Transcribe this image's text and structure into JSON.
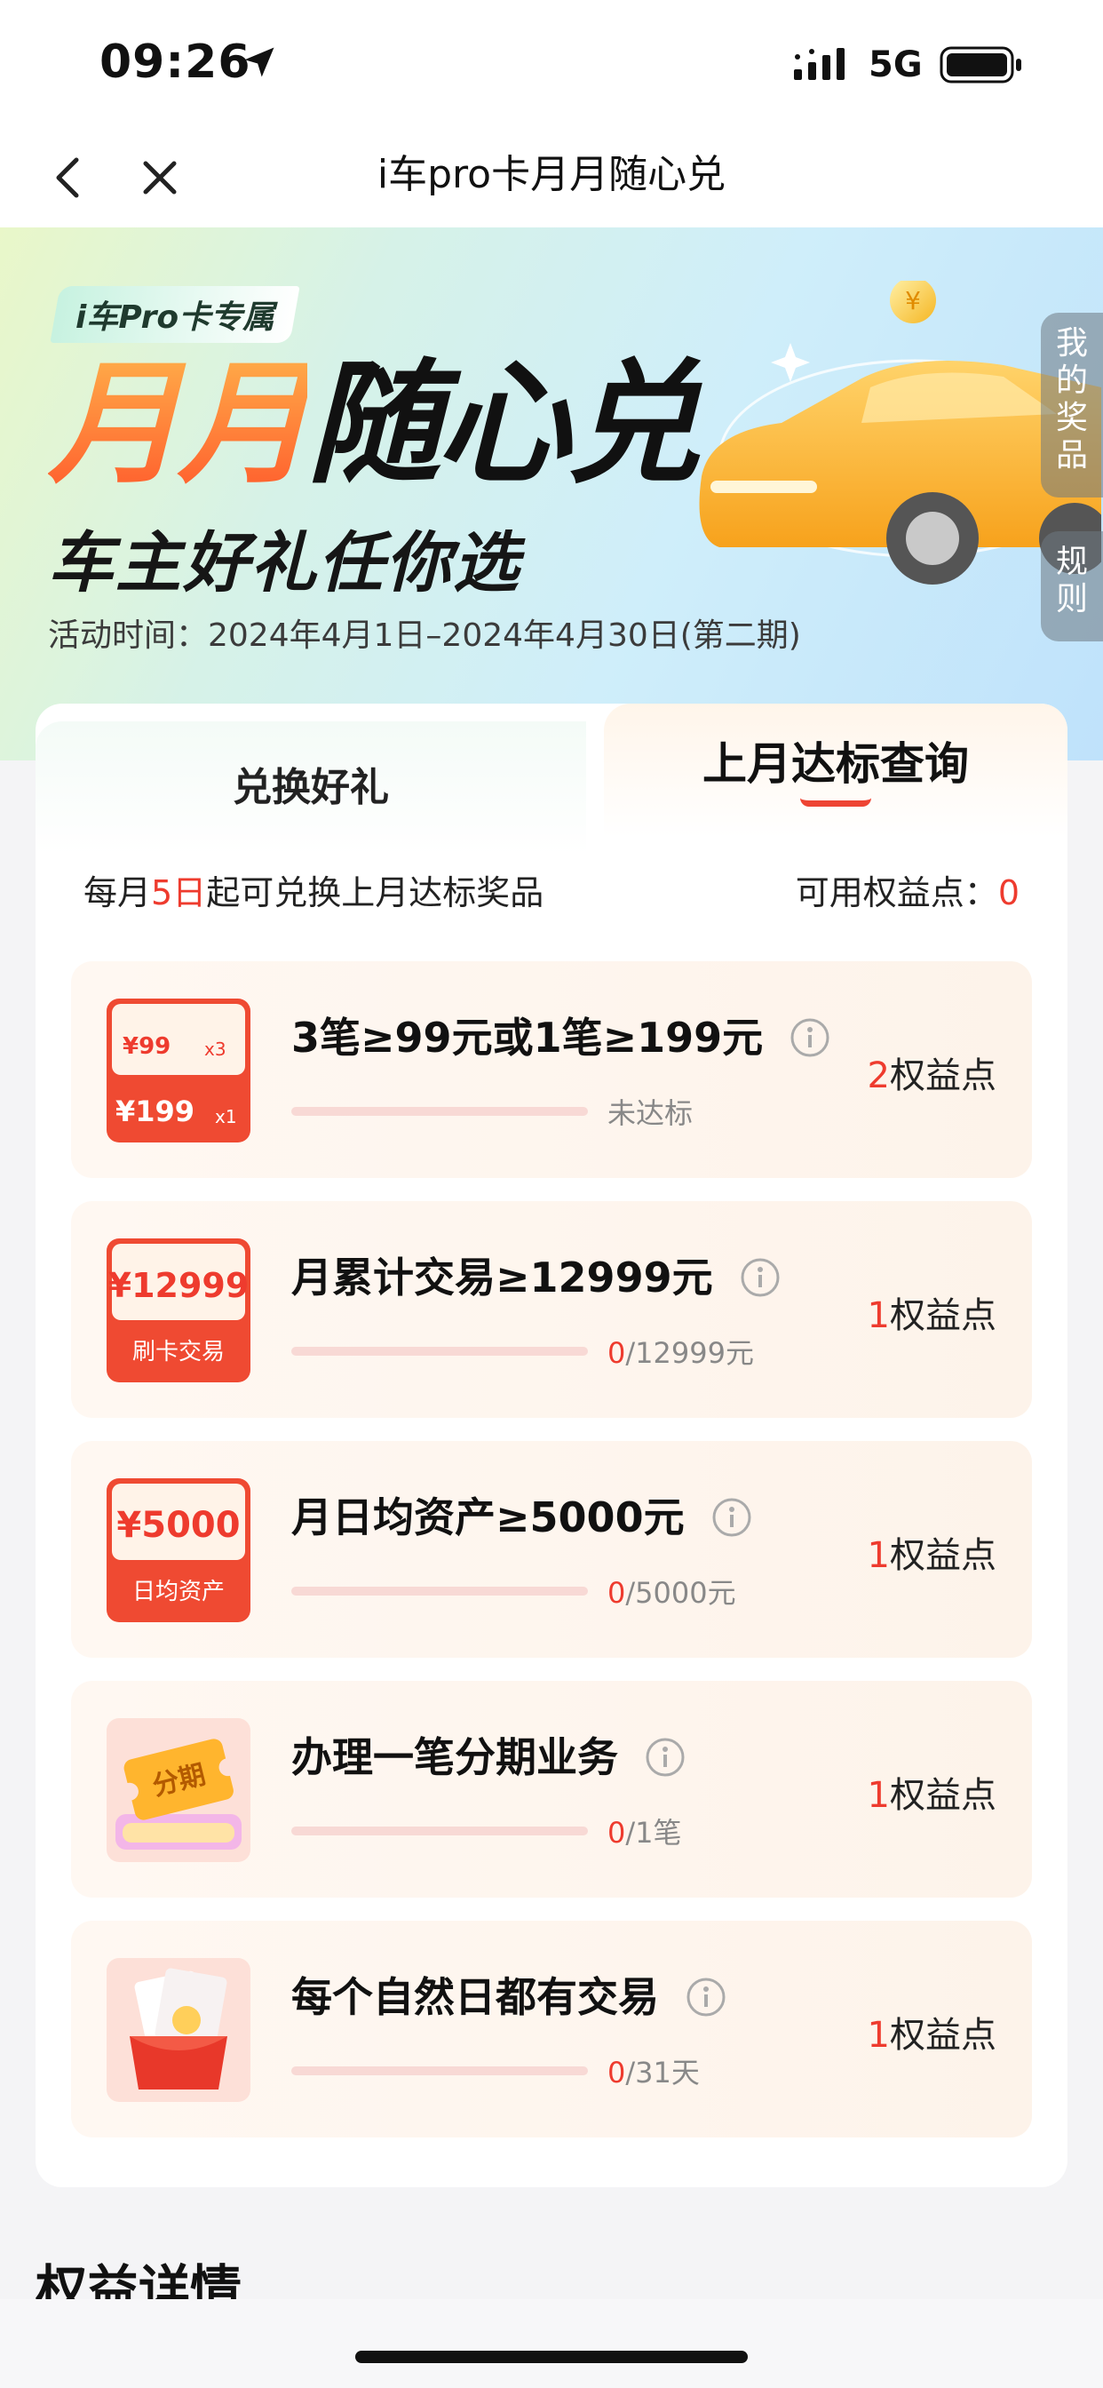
{
  "status_bar": {
    "time": "09:26",
    "network": "5G"
  },
  "nav": {
    "title": "i车pro卡月月随心兑"
  },
  "hero": {
    "badge": "i车Pro卡专属",
    "title_colored": "月月",
    "title_dark": "随心兑",
    "subtitle": "车主好礼任你选",
    "date": "活动时间：2024年4月1日–2024年4月30日(第二期)"
  },
  "side_tabs": {
    "prizes": "我的奖品",
    "rules": "规则"
  },
  "tabs": {
    "left": "兑换好礼",
    "right": "上月达标查询"
  },
  "info": {
    "pre": "每月",
    "day": "5日",
    "post": "起可兑换上月达标奖品",
    "points_label": "可用权益点：",
    "points_value": "0"
  },
  "tasks": [
    {
      "icon": "yuan-99-x3-199-x1-icon",
      "icon_top": "¥99",
      "icon_top_mult": "x3",
      "icon_bottom": "¥199",
      "icon_bottom_mult": "x1",
      "title": "3笔≥99元或1笔≥199元",
      "status": "未达标",
      "progress": 0,
      "points_num": "2",
      "points_unit": "权益点"
    },
    {
      "icon": "card-transaction-12999-icon",
      "icon_amount": "¥12999",
      "icon_label": "刷卡交易",
      "title": "月累计交易≥12999元",
      "progress_current": "0",
      "progress_total": "/12999元",
      "progress": 0,
      "points_num": "1",
      "points_unit": "权益点"
    },
    {
      "icon": "daily-assets-5000-icon",
      "icon_amount": "¥5000",
      "icon_label": "日均资产",
      "title": "月日均资产≥5000元",
      "progress_current": "0",
      "progress_total": "/5000元",
      "progress": 0,
      "points_num": "1",
      "points_unit": "权益点"
    },
    {
      "icon": "installment-ticket-icon",
      "icon_label": "分期",
      "title": "办理一笔分期业务",
      "progress_current": "0",
      "progress_total": "/1笔",
      "progress": 0,
      "points_num": "1",
      "points_unit": "权益点"
    },
    {
      "icon": "red-envelope-icon",
      "title": "每个自然日都有交易",
      "progress_current": "0",
      "progress_total": "/31天",
      "progress": 0,
      "points_num": "1",
      "points_unit": "权益点"
    }
  ],
  "section": {
    "title": "权益详情"
  },
  "colors": {
    "accent_red": "#ee3b2e",
    "orange": "#ff5a2c",
    "progress_bg": "#f8d9d5"
  }
}
